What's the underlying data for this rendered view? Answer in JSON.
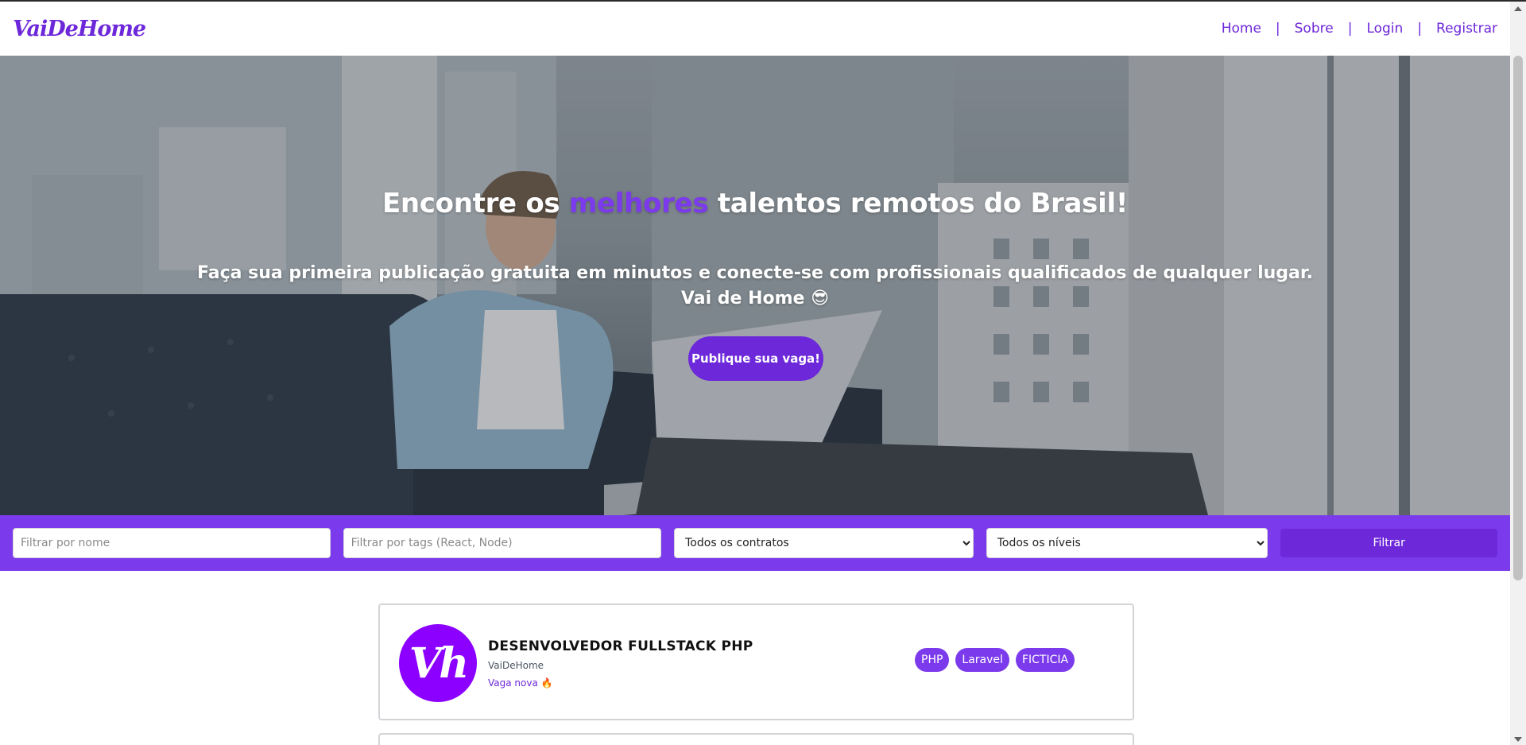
{
  "header": {
    "logo": "VaiDeHome",
    "nav": {
      "home": "Home",
      "about": "Sobre",
      "login": "Login",
      "register": "Registrar",
      "separator": "|"
    }
  },
  "hero": {
    "title_before": "Encontre os",
    "title_accent": "melhores",
    "title_after": "talentos remotos do Brasil!",
    "subtitle_line1": "Faça sua primeira publicação gratuita em minutos e conecte-se com profissionais qualificados de qualquer lugar.",
    "subtitle_line2": "Vai de Home 😎",
    "cta_label": "Publique sua vaga!"
  },
  "filters": {
    "name_placeholder": "Filtrar por nome",
    "tags_placeholder": "Filtrar por tags (React, Node)",
    "contract_selected": "Todos os contratos",
    "level_selected": "Todos os níveis",
    "filter_button": "Filtrar"
  },
  "jobs": [
    {
      "avatar_text": "Vh",
      "title": "DESENVOLVEDOR FULLSTACK PHP",
      "company": "VaiDeHome",
      "badge": "Vaga nova 🔥",
      "tags": [
        "PHP",
        "Laravel",
        "FICTICIA"
      ]
    }
  ],
  "colors": {
    "brand": "#6d28d9",
    "filter_bar": "#7c3aed",
    "avatar": "#8b00ff"
  }
}
